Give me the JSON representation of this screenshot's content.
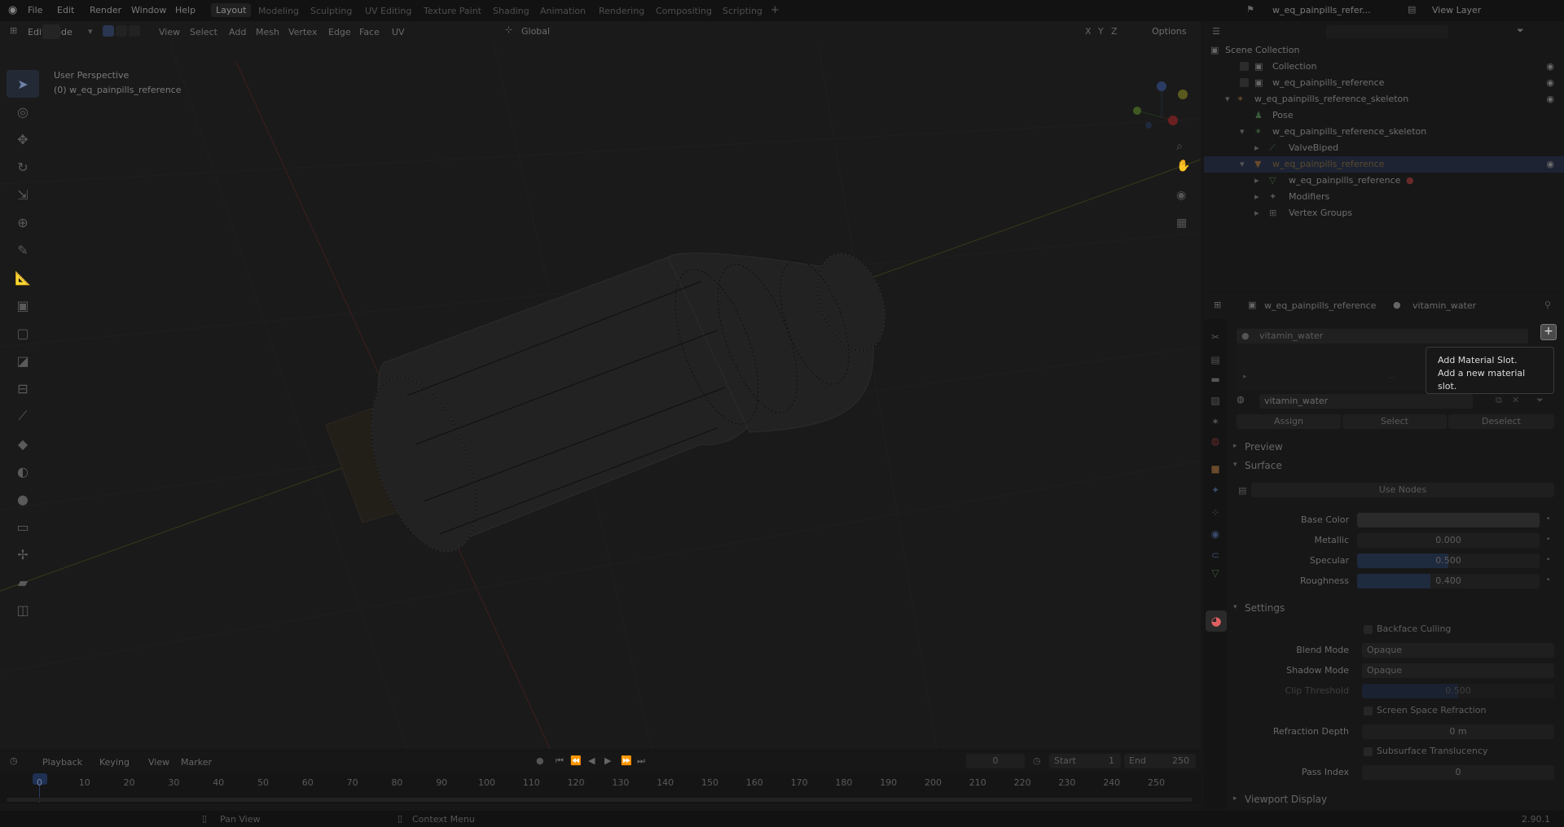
{
  "topbar": {
    "menus": [
      "File",
      "Edit",
      "Render",
      "Window",
      "Help"
    ],
    "workspaces": [
      "Layout",
      "Modeling",
      "Sculpting",
      "UV Editing",
      "Texture Paint",
      "Shading",
      "Animation",
      "Rendering",
      "Compositing",
      "Scripting"
    ],
    "active_workspace": "Layout",
    "scene_name": "w_eq_painpills_refer...",
    "view_layer": "View Layer"
  },
  "viewport_header": {
    "mode": "Edit Mode",
    "menus": [
      "View",
      "Select",
      "Add",
      "Mesh",
      "Vertex",
      "Edge",
      "Face",
      "UV"
    ],
    "orientation": "Global",
    "axes": [
      "X",
      "Y",
      "Z"
    ],
    "options": "Options"
  },
  "viewport": {
    "perspective": "User Perspective",
    "object_label": "(0) w_eq_painpills_reference"
  },
  "outliner": {
    "root": "Scene Collection",
    "rows": [
      {
        "label": "Collection"
      },
      {
        "label": "w_eq_painpills_reference"
      },
      {
        "label": "w_eq_painpills_reference_skeleton"
      },
      {
        "label": "Pose"
      },
      {
        "label": "w_eq_painpills_reference_skeleton"
      },
      {
        "label": "ValveBiped"
      },
      {
        "label": "w_eq_painpills_reference"
      },
      {
        "label": "w_eq_painpills_reference"
      },
      {
        "label": "Modifiers"
      },
      {
        "label": "Vertex Groups"
      }
    ]
  },
  "properties": {
    "breadcrumb_object": "w_eq_painpills_reference",
    "breadcrumb_material": "vitamin_water",
    "material_slot": "vitamin_water",
    "material_name": "vitamin_water",
    "assign": "Assign",
    "select": "Select",
    "deselect": "Deselect",
    "preview": "Preview",
    "surface": "Surface",
    "use_nodes": "Use Nodes",
    "base_color_label": "Base Color",
    "metallic_label": "Metallic",
    "metallic_value": "0.000",
    "specular_label": "Specular",
    "specular_value": "0.500",
    "specular_fraction": 0.5,
    "roughness_label": "Roughness",
    "roughness_value": "0.400",
    "roughness_fraction": 0.4,
    "settings": "Settings",
    "backface_culling": "Backface Culling",
    "blend_mode_label": "Blend Mode",
    "blend_mode_value": "Opaque",
    "shadow_mode_label": "Shadow Mode",
    "shadow_mode_value": "Opaque",
    "clip_threshold_label": "Clip Threshold",
    "clip_threshold_value": "0.500",
    "ssr": "Screen Space Refraction",
    "refraction_depth_label": "Refraction Depth",
    "refraction_depth_value": "0 m",
    "subsurface": "Subsurface Translucency",
    "pass_index_label": "Pass Index",
    "pass_index_value": "0",
    "viewport_display": "Viewport Display"
  },
  "tooltip": {
    "title": "Add Material Slot.",
    "description": "Add a new material slot."
  },
  "timeline": {
    "menus": [
      "Playback",
      "Keying",
      "View",
      "Marker"
    ],
    "current_frame": "0",
    "start_label": "Start",
    "start_value": "1",
    "end_label": "End",
    "end_value": "250",
    "ticks": [
      "0",
      "10",
      "20",
      "30",
      "40",
      "50",
      "60",
      "70",
      "80",
      "90",
      "100",
      "110",
      "120",
      "130",
      "140",
      "150",
      "160",
      "170",
      "180",
      "190",
      "200",
      "210",
      "220",
      "230",
      "240",
      "250"
    ]
  },
  "statusbar": {
    "pan_view": "Pan View",
    "context_menu": "Context Menu",
    "version": "2.90.1"
  },
  "colors": {
    "accent_blue": "#4772b3",
    "selection": "#1d2333",
    "tooltip_text": "#dcdcdc"
  }
}
